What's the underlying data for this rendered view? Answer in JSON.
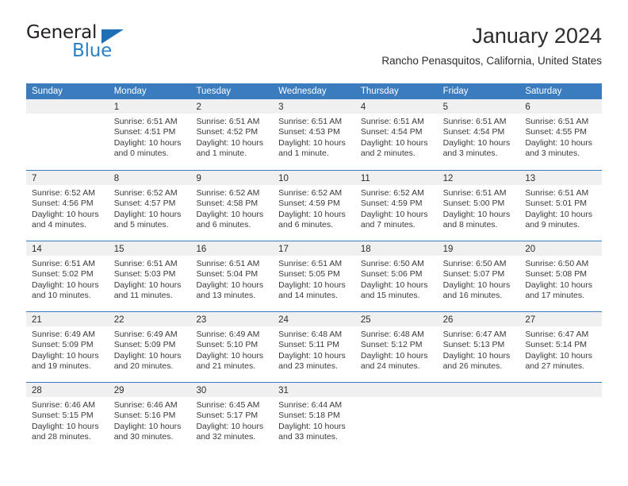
{
  "brand": {
    "name_top": "General",
    "name_bottom": "Blue",
    "triangle_color": "#1f6fb4",
    "top_color": "#231f20",
    "bottom_color": "#2980c4",
    "logo_icon": "general-blue-logo-triangle-icon"
  },
  "header": {
    "month_title": "January 2024",
    "location": "Rancho Penasquitos, California, United States"
  },
  "theme": {
    "header_blue": "#3a7cbe",
    "daynum_band": "#f0f0f0",
    "text": "#3a3a3a"
  },
  "calendar": {
    "weekday_headers": [
      "Sunday",
      "Monday",
      "Tuesday",
      "Wednesday",
      "Thursday",
      "Friday",
      "Saturday"
    ],
    "weeks": [
      [
        {
          "day": "",
          "lines": []
        },
        {
          "day": "1",
          "lines": [
            "Sunrise: 6:51 AM",
            "Sunset: 4:51 PM",
            "Daylight: 10 hours",
            "and 0 minutes."
          ]
        },
        {
          "day": "2",
          "lines": [
            "Sunrise: 6:51 AM",
            "Sunset: 4:52 PM",
            "Daylight: 10 hours",
            "and 1 minute."
          ]
        },
        {
          "day": "3",
          "lines": [
            "Sunrise: 6:51 AM",
            "Sunset: 4:53 PM",
            "Daylight: 10 hours",
            "and 1 minute."
          ]
        },
        {
          "day": "4",
          "lines": [
            "Sunrise: 6:51 AM",
            "Sunset: 4:54 PM",
            "Daylight: 10 hours",
            "and 2 minutes."
          ]
        },
        {
          "day": "5",
          "lines": [
            "Sunrise: 6:51 AM",
            "Sunset: 4:54 PM",
            "Daylight: 10 hours",
            "and 3 minutes."
          ]
        },
        {
          "day": "6",
          "lines": [
            "Sunrise: 6:51 AM",
            "Sunset: 4:55 PM",
            "Daylight: 10 hours",
            "and 3 minutes."
          ]
        }
      ],
      [
        {
          "day": "7",
          "lines": [
            "Sunrise: 6:52 AM",
            "Sunset: 4:56 PM",
            "Daylight: 10 hours",
            "and 4 minutes."
          ]
        },
        {
          "day": "8",
          "lines": [
            "Sunrise: 6:52 AM",
            "Sunset: 4:57 PM",
            "Daylight: 10 hours",
            "and 5 minutes."
          ]
        },
        {
          "day": "9",
          "lines": [
            "Sunrise: 6:52 AM",
            "Sunset: 4:58 PM",
            "Daylight: 10 hours",
            "and 6 minutes."
          ]
        },
        {
          "day": "10",
          "lines": [
            "Sunrise: 6:52 AM",
            "Sunset: 4:59 PM",
            "Daylight: 10 hours",
            "and 6 minutes."
          ]
        },
        {
          "day": "11",
          "lines": [
            "Sunrise: 6:52 AM",
            "Sunset: 4:59 PM",
            "Daylight: 10 hours",
            "and 7 minutes."
          ]
        },
        {
          "day": "12",
          "lines": [
            "Sunrise: 6:51 AM",
            "Sunset: 5:00 PM",
            "Daylight: 10 hours",
            "and 8 minutes."
          ]
        },
        {
          "day": "13",
          "lines": [
            "Sunrise: 6:51 AM",
            "Sunset: 5:01 PM",
            "Daylight: 10 hours",
            "and 9 minutes."
          ]
        }
      ],
      [
        {
          "day": "14",
          "lines": [
            "Sunrise: 6:51 AM",
            "Sunset: 5:02 PM",
            "Daylight: 10 hours",
            "and 10 minutes."
          ]
        },
        {
          "day": "15",
          "lines": [
            "Sunrise: 6:51 AM",
            "Sunset: 5:03 PM",
            "Daylight: 10 hours",
            "and 11 minutes."
          ]
        },
        {
          "day": "16",
          "lines": [
            "Sunrise: 6:51 AM",
            "Sunset: 5:04 PM",
            "Daylight: 10 hours",
            "and 13 minutes."
          ]
        },
        {
          "day": "17",
          "lines": [
            "Sunrise: 6:51 AM",
            "Sunset: 5:05 PM",
            "Daylight: 10 hours",
            "and 14 minutes."
          ]
        },
        {
          "day": "18",
          "lines": [
            "Sunrise: 6:50 AM",
            "Sunset: 5:06 PM",
            "Daylight: 10 hours",
            "and 15 minutes."
          ]
        },
        {
          "day": "19",
          "lines": [
            "Sunrise: 6:50 AM",
            "Sunset: 5:07 PM",
            "Daylight: 10 hours",
            "and 16 minutes."
          ]
        },
        {
          "day": "20",
          "lines": [
            "Sunrise: 6:50 AM",
            "Sunset: 5:08 PM",
            "Daylight: 10 hours",
            "and 17 minutes."
          ]
        }
      ],
      [
        {
          "day": "21",
          "lines": [
            "Sunrise: 6:49 AM",
            "Sunset: 5:09 PM",
            "Daylight: 10 hours",
            "and 19 minutes."
          ]
        },
        {
          "day": "22",
          "lines": [
            "Sunrise: 6:49 AM",
            "Sunset: 5:09 PM",
            "Daylight: 10 hours",
            "and 20 minutes."
          ]
        },
        {
          "day": "23",
          "lines": [
            "Sunrise: 6:49 AM",
            "Sunset: 5:10 PM",
            "Daylight: 10 hours",
            "and 21 minutes."
          ]
        },
        {
          "day": "24",
          "lines": [
            "Sunrise: 6:48 AM",
            "Sunset: 5:11 PM",
            "Daylight: 10 hours",
            "and 23 minutes."
          ]
        },
        {
          "day": "25",
          "lines": [
            "Sunrise: 6:48 AM",
            "Sunset: 5:12 PM",
            "Daylight: 10 hours",
            "and 24 minutes."
          ]
        },
        {
          "day": "26",
          "lines": [
            "Sunrise: 6:47 AM",
            "Sunset: 5:13 PM",
            "Daylight: 10 hours",
            "and 26 minutes."
          ]
        },
        {
          "day": "27",
          "lines": [
            "Sunrise: 6:47 AM",
            "Sunset: 5:14 PM",
            "Daylight: 10 hours",
            "and 27 minutes."
          ]
        }
      ],
      [
        {
          "day": "28",
          "lines": [
            "Sunrise: 6:46 AM",
            "Sunset: 5:15 PM",
            "Daylight: 10 hours",
            "and 28 minutes."
          ]
        },
        {
          "day": "29",
          "lines": [
            "Sunrise: 6:46 AM",
            "Sunset: 5:16 PM",
            "Daylight: 10 hours",
            "and 30 minutes."
          ]
        },
        {
          "day": "30",
          "lines": [
            "Sunrise: 6:45 AM",
            "Sunset: 5:17 PM",
            "Daylight: 10 hours",
            "and 32 minutes."
          ]
        },
        {
          "day": "31",
          "lines": [
            "Sunrise: 6:44 AM",
            "Sunset: 5:18 PM",
            "Daylight: 10 hours",
            "and 33 minutes."
          ]
        },
        {
          "day": "",
          "lines": []
        },
        {
          "day": "",
          "lines": []
        },
        {
          "day": "",
          "lines": []
        }
      ]
    ]
  }
}
